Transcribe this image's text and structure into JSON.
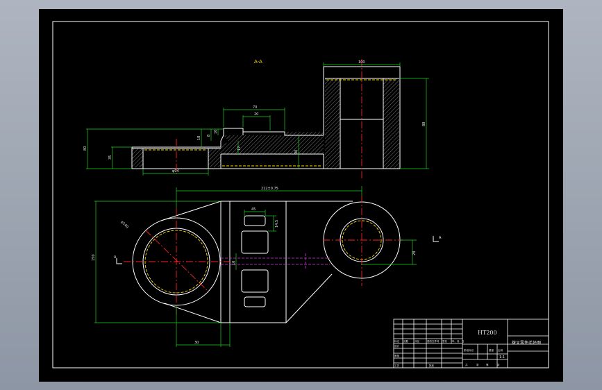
{
  "section_label": "A-A",
  "dims_front": {
    "top_width": "100",
    "boss_width": "70",
    "boss_inner": "20",
    "total_height": "80",
    "left_height": "35",
    "bottom_width": "φ94",
    "left_step": "18",
    "step_a": "8",
    "step_b": "10",
    "web": "17",
    "web_height": "30",
    "right_height": "88"
  },
  "dims_top": {
    "center_distance": "212±0.75",
    "big_diameter": "φ140",
    "overall_height": "150",
    "slot_width": "45",
    "slot_height": "14.5",
    "offset": "30",
    "rib_width": "10",
    "right_offset": "28"
  },
  "title_block": {
    "material": "HT200",
    "drawing_name": "拨叉零件毛坯图",
    "scale": "1:1",
    "rows": [
      "标记",
      "处数",
      "分区",
      "更改文件号",
      "签名",
      "年、月、日"
    ],
    "labels": [
      "设计",
      "审核",
      "工艺",
      "阶段标记",
      "重量",
      "比例",
      "共",
      "张",
      "第",
      "张",
      "批准"
    ]
  },
  "colors": {
    "background": "#000000",
    "outline": "#ffffff",
    "dimension": "#22d022",
    "center_line": "#ff2020",
    "hidden_line": "#ffe000",
    "section": "#d03adc"
  }
}
